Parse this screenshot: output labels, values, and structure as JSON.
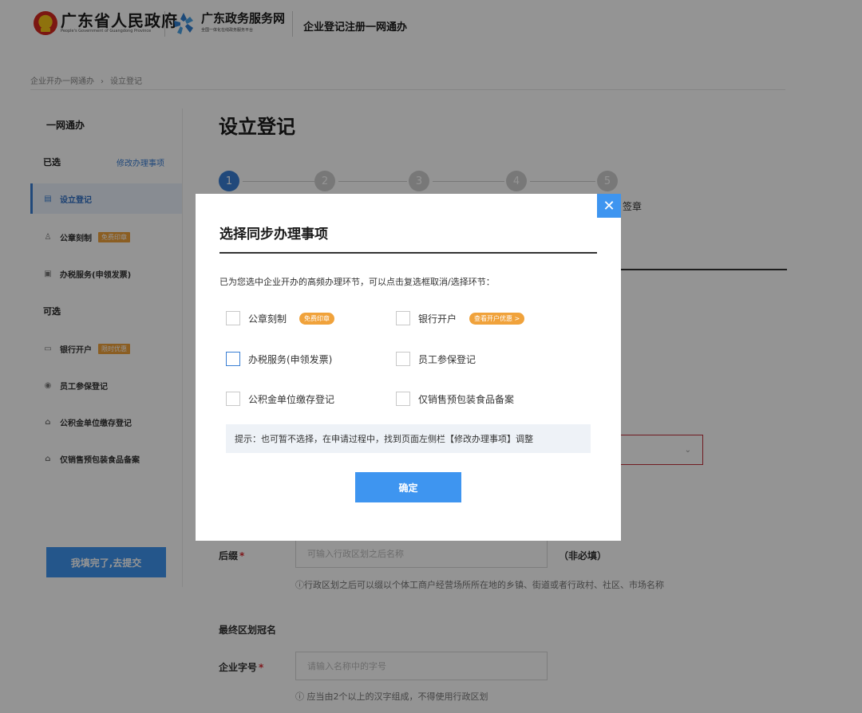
{
  "header": {
    "gov_title": "广东省人民政府",
    "gov_subtitle": "People's Government of Guangdong Province",
    "service_title": "广东政务服务网",
    "service_subtitle": "全国一体化在线政务服务平台",
    "page_title": "企业登记注册一网通办"
  },
  "breadcrumb": [
    "企业开办一网通办",
    "设立登记"
  ],
  "breadcrumb_sep": "›",
  "sidebar": {
    "heading": "一网通办",
    "selected_label": "已选",
    "modify_link": "修改办理事项",
    "optional_label": "可选",
    "selected_items": [
      {
        "label": "设立登记",
        "icon": "building-icon"
      },
      {
        "label": "公章刻制",
        "badge": "免费印章",
        "icon": "seal-icon"
      },
      {
        "label": "办税服务(申领发票)",
        "icon": "invoice-icon"
      }
    ],
    "optional_items": [
      {
        "label": "银行开户",
        "badge": "限时优惠",
        "icon": "bank-card-icon"
      },
      {
        "label": "员工参保登记",
        "icon": "insurance-icon"
      },
      {
        "label": "公积金单位缴存登记",
        "icon": "fund-icon"
      },
      {
        "label": "仅销售预包装食品备案",
        "icon": "food-icon"
      }
    ],
    "submit_label": "我填完了,去提交"
  },
  "main": {
    "title": "设立登记",
    "steps": [
      "1",
      "2",
      "3",
      "4",
      "5"
    ],
    "active_step": 1,
    "step5_label_tail": "签章",
    "select_chevron": "⌄",
    "suffix_label": "后缀",
    "required_mark": "*",
    "suffix_placeholder": "可输入行政区划之后名称",
    "suffix_note": "（非必填）",
    "suffix_hint": "ⓘ行政区划之后可以缀以个体工商户经营场所所在地的乡镇、街道或者行政村、社区、市场名称",
    "region_label": "最终区划冠名",
    "name_label": "企业字号",
    "name_placeholder": "请输入名称中的字号",
    "name_hint": "ⓘ 应当由2个以上的汉字组成，不得使用行政区划"
  },
  "modal": {
    "close_glyph": "✕",
    "title": "选择同步办理事项",
    "description": "已为您选中企业开办的高频办理环节，可以点击复选框取消/选择环节：",
    "options": [
      {
        "label": "公章刻制",
        "badge": "免费印章"
      },
      {
        "label": "银行开户",
        "badge": "查看开户优惠 >"
      },
      {
        "label": "办税服务(申领发票)"
      },
      {
        "label": "员工参保登记"
      },
      {
        "label": "公积金单位缴存登记"
      },
      {
        "label": "仅销售预包装食品备案"
      }
    ],
    "tip": "提示：也可暂不选择，在申请过程中，找到页面左侧栏【修改办理事项】调整",
    "confirm_label": "确定"
  },
  "colors": {
    "primary_blue": "#3e95f0",
    "badge_orange": "#f0a23b",
    "error_red": "#c2303a"
  }
}
